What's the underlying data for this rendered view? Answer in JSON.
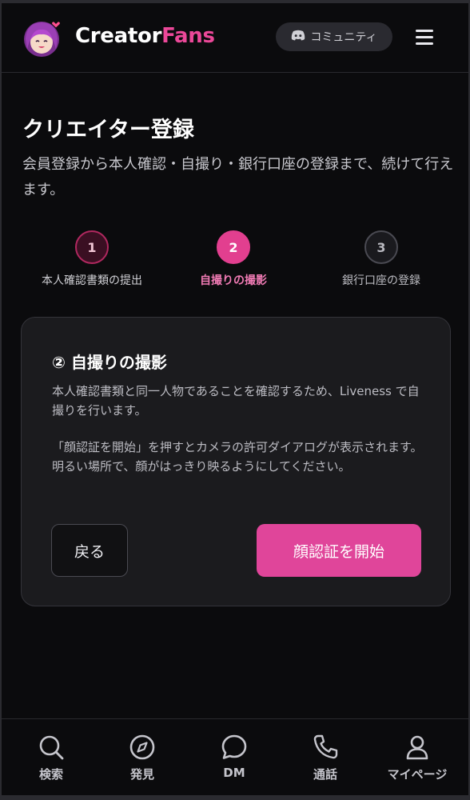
{
  "header": {
    "brand_part1": "Creator",
    "brand_part2": "Fans",
    "community_label": "コミュニティ",
    "avatar_icon": "anime-avatar-icon",
    "community_icon": "discord-icon",
    "menu_icon": "hamburger-menu-icon"
  },
  "page": {
    "title": "クリエイター登録",
    "subtitle": "会員登録から本人確認・自撮り・銀行口座の登録まで、続けて行えます。"
  },
  "steps": [
    {
      "number": "1",
      "label": "本人確認書類の提出",
      "state": "done"
    },
    {
      "number": "2",
      "label": "自撮りの撮影",
      "state": "current"
    },
    {
      "number": "3",
      "label": "銀行口座の登録",
      "state": "upcoming"
    }
  ],
  "card": {
    "title": "② 自撮りの撮影",
    "text1": "本人確認書類と同一人物であることを確認するため、Liveness で自撮りを行います。",
    "text2": "「顔認証を開始」を押すとカメラの許可ダイアログが表示されます。明るい場所で、顔がはっきり映るようにしてください。",
    "back_label": "戻る",
    "start_label": "顔認証を開始"
  },
  "bottom_nav": [
    {
      "label": "検索",
      "icon": "search-icon"
    },
    {
      "label": "発見",
      "icon": "compass-icon"
    },
    {
      "label": "DM",
      "icon": "chat-bubble-icon"
    },
    {
      "label": "通話",
      "icon": "phone-icon"
    },
    {
      "label": "マイページ",
      "icon": "user-icon"
    }
  ],
  "colors": {
    "accent": "#e0459a",
    "background": "#0b0b0d",
    "card": "#1b1b1e"
  }
}
